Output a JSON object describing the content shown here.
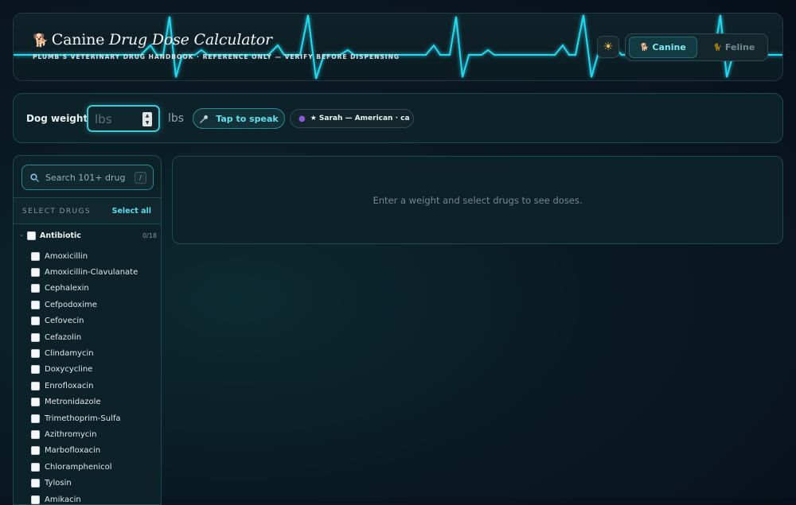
{
  "header": {
    "title_plain": "Canine ",
    "title_italic": "Drug Dose Calculator",
    "subtitle": "PLUMB'S VETERINARY DRUG HANDBOOK · REFERENCE ONLY — VERIFY BEFORE DISPENSING",
    "paw_icon": "🐕",
    "theme_icon": "☀",
    "species": [
      {
        "label": "Canine",
        "icon": "🐕",
        "active": true
      },
      {
        "label": "Feline",
        "icon": "🐈",
        "active": false
      }
    ]
  },
  "weight": {
    "label": "Dog weight",
    "placeholder": "lbs",
    "value": "",
    "unit": "lbs",
    "speak_label": "Tap to speak",
    "voice_selected": "★ Sarah — American · ca"
  },
  "sidebar": {
    "search_placeholder": "Search 101+ drug",
    "search_shortcut": "/",
    "select_title": "SELECT DRUGS",
    "select_all": "Select all",
    "category": {
      "name": "Antibiotic",
      "count": "0/18"
    },
    "drugs": [
      "Amoxicillin",
      "Amoxicillin-Clavulanate",
      "Cephalexin",
      "Cefpodoxime",
      "Cefovecin",
      "Cefazolin",
      "Clindamycin",
      "Doxycycline",
      "Enrofloxacin",
      "Metronidazole",
      "Trimethoprim-Sulfa",
      "Azithromycin",
      "Marbofloxacin",
      "Chloramphenicol",
      "Tylosin",
      "Amikacin"
    ]
  },
  "results": {
    "empty_message": "Enter a weight and select drugs to see doses."
  },
  "colors": {
    "accent": "#3ec8d8",
    "ekg": "#28d9f0",
    "background": "#0a1a24"
  }
}
